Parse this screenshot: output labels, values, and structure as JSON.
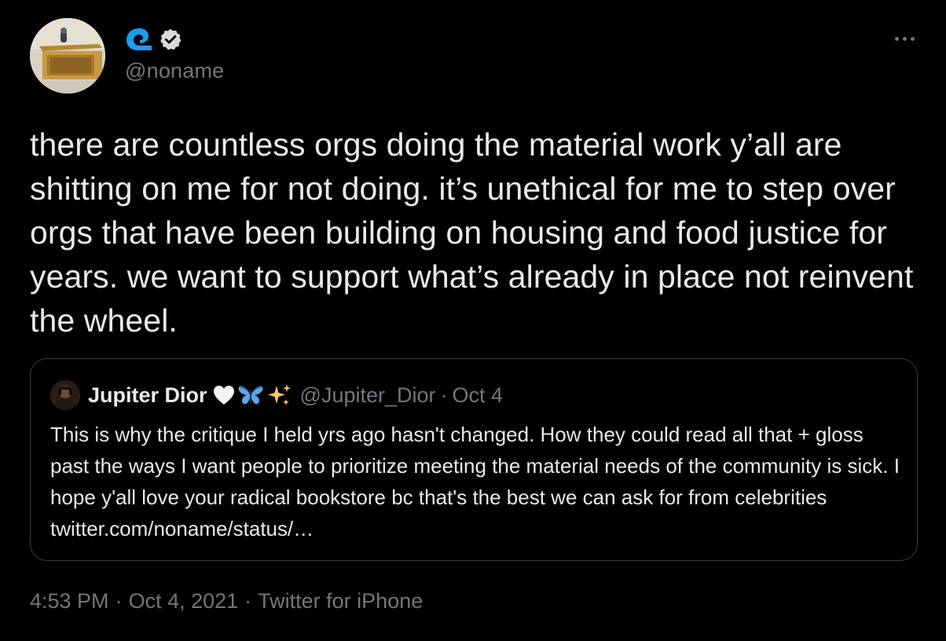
{
  "author": {
    "handle": "@noname",
    "avatar_icon": "profile-photo-desk",
    "name_icon": "wave-icon",
    "verified_icon": "verified-badge-icon"
  },
  "more_icon": "more-options-icon",
  "tweet_text": "there are countless orgs doing the material work y’all are shitting on me for not doing. it’s unethical for me to step over orgs that have been building on housing and food justice for years. we want to support what’s already in place not reinvent the wheel.",
  "quote": {
    "name": "Jupiter Dior",
    "emojis": [
      "white-heart",
      "butterfly",
      "sparkles"
    ],
    "handle": "@Jupiter_Dior",
    "separator": "·",
    "date": "Oct 4",
    "text": "This is why the critique I held yrs ago hasn't changed. How they could read all that + gloss past the ways I want people to prioritize meeting the material needs of the community is sick. I hope y'all love your radical bookstore bc that's the best we can ask for from celebrities twitter.com/noname/status/…"
  },
  "footer": {
    "time": "4:53 PM",
    "date": "Oct 4, 2021",
    "source": "Twitter for iPhone",
    "separator": "·"
  },
  "colors": {
    "background": "#000000",
    "text": "#e7e9ea",
    "secondary": "#71767b",
    "wave": "#1d9bf0",
    "border": "#3a3d40"
  }
}
